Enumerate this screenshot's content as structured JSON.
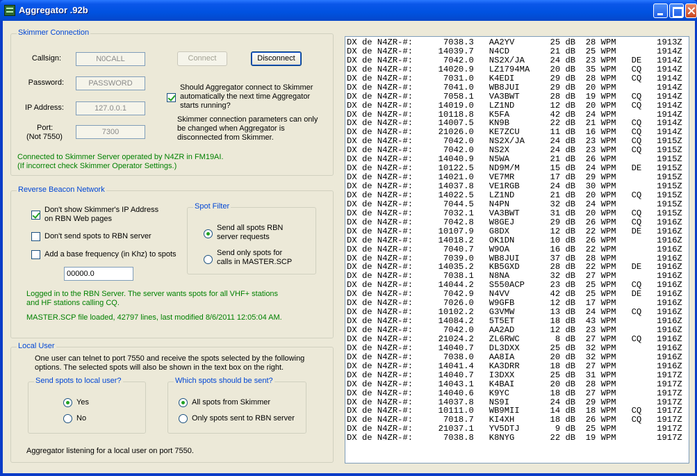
{
  "window": {
    "title": "Aggregator .92b"
  },
  "skimmer": {
    "group_title": "Skimmer Connection",
    "callsign_label": "Callsign:",
    "callsign_value": "N0CALL",
    "password_label": "Password:",
    "password_value": "PASSWORD",
    "ip_label": "IP Address:",
    "ip_value": "127.0.0.1",
    "port_label_1": "Port:",
    "port_label_2": "(Not 7550)",
    "port_value": "7300",
    "connect_label": "Connect",
    "disconnect_label": "Disconnect",
    "autoconnect_line1": "Should Aggregator connect to Skimmer",
    "autoconnect_line2": "automatically the next time Aggregator",
    "autoconnect_line3": "starts running?",
    "autoconnect_checked": true,
    "note_line1": "Skimmer connection parameters can only",
    "note_line2": "be changed when Aggregator is",
    "note_line3": "disconnected from Skimmer.",
    "status_line1": "Connected to Skimmer Server operated by N4ZR in FM19AI.",
    "status_line2": "(If incorrect check Skimmer Operator Settings.)"
  },
  "rbn": {
    "group_title": "Reverse Beacon Network",
    "hide_ip_line1": "Don't show Skimmer's IP Address",
    "hide_ip_line2": "on RBN Web pages",
    "hide_ip_checked": true,
    "dont_send_label": "Don't send spots to RBN server",
    "dont_send_checked": false,
    "base_freq_label": "Add a base frequency (in Khz) to spots",
    "base_freq_checked": false,
    "base_freq_value": "00000.0",
    "spot_filter_title": "Spot Filter",
    "filter_all_line1": "Send all spots RBN",
    "filter_all_line2": "server requests",
    "filter_master_line1": "Send only spots for",
    "filter_master_line2": "calls in MASTER.SCP",
    "filter_selected": "all",
    "status_line1": "Logged in to the RBN Server. The server wants spots for all VHF+ stations",
    "status_line2": "and HF stations calling CQ.",
    "master_status": "MASTER.SCP file loaded, 42797 lines, last modified 8/6/2011 12:05:04 AM."
  },
  "local_user": {
    "group_title": "Local User",
    "desc_line1": "One user can telnet to port 7550 and receive the spots selected by the following",
    "desc_line2": "options.  The selected spots will also be shown in the text box on the right.",
    "send_group_title": "Send spots to local user?",
    "yes_label": "Yes",
    "no_label": "No",
    "send_selected": "yes",
    "which_group_title": "Which spots should be sent?",
    "all_spots_label": "All spots from Skimmer",
    "only_rbn_label": "Only spots sent to RBN server",
    "which_selected": "all",
    "listening_status": "Aggregator listening for a local user on port 7550."
  },
  "spots": [
    "DX de N4ZR-#:      7038.3   AA2YV       25 dB  28 WPM        1913Z",
    "DX de N4ZR-#:     14039.7   N4CD        21 dB  25 WPM        1914Z",
    "DX de N4ZR-#:      7042.0   NS2X/JA     24 dB  23 WPM   DE   1914Z",
    "DX de N4ZR-#:     14020.9   LZ1794MA    20 dB  35 WPM   CQ   1914Z",
    "DX de N4ZR-#:      7031.0   K4EDI       29 dB  28 WPM   CQ   1914Z",
    "DX de N4ZR-#:      7041.0   WB8JUI      29 dB  20 WPM        1914Z",
    "DX de N4ZR-#:      7058.1   VA3BWT      28 dB  19 WPM   CQ   1914Z",
    "DX de N4ZR-#:     14019.0   LZ1ND       12 dB  20 WPM   CQ   1914Z",
    "DX de N4ZR-#:     10118.8   K5FA        42 dB  24 WPM        1914Z",
    "DX de N4ZR-#:     14007.5   KN9B        22 dB  21 WPM   CQ   1914Z",
    "DX de N4ZR-#:     21026.0   KE7ZCU      11 dB  16 WPM   CQ   1914Z",
    "DX de N4ZR-#:      7042.0   NS2X/JA     24 dB  23 WPM   CQ   1915Z",
    "DX de N4ZR-#:      7042.0   NS2X        24 dB  23 WPM   CQ   1915Z",
    "DX de N4ZR-#:     14040.9   N5WA        21 dB  26 WPM        1915Z",
    "DX de N4ZR-#:     10122.5   ND9M/M      15 dB  24 WPM   DE   1915Z",
    "DX de N4ZR-#:     14021.0   VE7MR       17 dB  29 WPM        1915Z",
    "DX de N4ZR-#:     14037.8   VE1RGB      24 dB  30 WPM        1915Z",
    "DX de N4ZR-#:     14022.5   LZ1ND       21 dB  20 WPM   CQ   1915Z",
    "DX de N4ZR-#:      7044.5   N4PN        32 dB  24 WPM        1915Z",
    "DX de N4ZR-#:      7032.1   VA3BWT      31 dB  20 WPM   CQ   1915Z",
    "DX de N4ZR-#:      7042.8   W8GEJ       29 dB  26 WPM   CQ   1916Z",
    "DX de N4ZR-#:     10107.9   G8DX        12 dB  22 WPM   DE   1916Z",
    "DX de N4ZR-#:     14018.2   OK1DN       10 dB  26 WPM        1916Z",
    "DX de N4ZR-#:      7040.7   W9OA        16 dB  22 WPM        1916Z",
    "DX de N4ZR-#:      7039.0   WB8JUI      37 dB  28 WPM        1916Z",
    "DX de N4ZR-#:     14035.2   KB5GXD      28 dB  22 WPM   DE   1916Z",
    "DX de N4ZR-#:      7038.1   N8NA        32 dB  27 WPM        1916Z",
    "DX de N4ZR-#:     14044.2   S550ACP     23 dB  25 WPM   CQ   1916Z",
    "DX de N4ZR-#:      7042.9   N4VV        42 dB  25 WPM   DE   1916Z",
    "DX de N4ZR-#:      7026.0   W9GFB       12 dB  17 WPM        1916Z",
    "DX de N4ZR-#:     10102.2   G3VMW       13 dB  24 WPM   CQ   1916Z",
    "DX de N4ZR-#:     14084.2   5T5ET       18 dB  43 WPM        1916Z",
    "DX de N4ZR-#:      7042.0   AA2AD       12 dB  23 WPM        1916Z",
    "DX de N4ZR-#:     21024.2   ZL6RWC       8 dB  27 WPM   CQ   1916Z",
    "DX de N4ZR-#:     14040.7   DL3DXX      25 dB  32 WPM        1916Z",
    "DX de N4ZR-#:      7038.0   AA8IA       20 dB  32 WPM        1916Z",
    "DX de N4ZR-#:     14041.4   KA3DRR      18 dB  27 WPM        1916Z",
    "DX de N4ZR-#:     14040.7   I3DXX       25 dB  31 WPM        1917Z",
    "DX de N4ZR-#:     14043.1   K4BAI       20 dB  28 WPM        1917Z",
    "DX de N4ZR-#:     14040.6   K9YC        18 dB  27 WPM        1917Z",
    "DX de N4ZR-#:     14037.8   NS9I        24 dB  29 WPM        1917Z",
    "DX de N4ZR-#:     10111.0   WB9MII      14 dB  18 WPM   CQ   1917Z",
    "DX de N4ZR-#:      7018.7   KI4XH       18 dB  26 WPM   CQ   1917Z",
    "DX de N4ZR-#:     21037.1   YV5DTJ       9 dB  25 WPM        1917Z",
    "DX de N4ZR-#:      7038.8   K8NYG       22 dB  19 WPM        1917Z"
  ]
}
